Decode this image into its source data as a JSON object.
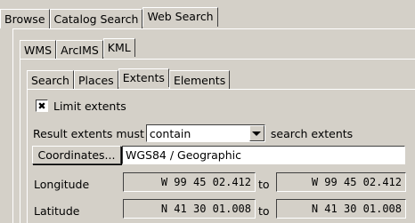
{
  "top_tabs": [
    "Browse",
    "Catalog Search",
    "Web Search"
  ],
  "service_tabs": [
    "WMS",
    "ArcIMS",
    "KML"
  ],
  "kml_tabs": [
    "Search",
    "Places",
    "Extents",
    "Elements"
  ],
  "limit_extents": {
    "label": "Limit extents",
    "checked": true,
    "mark": "✖"
  },
  "result_extents": {
    "prefix": "Result extents must",
    "value": "contain",
    "suffix": "search extents"
  },
  "coordinates": {
    "button_label": "Coordinates...",
    "system": "WGS84 / Geographic"
  },
  "longitude": {
    "label": "Longitude",
    "from": "W 99 45 02.412",
    "to_label": "to",
    "to": "W 99 45 02.412"
  },
  "latitude": {
    "label": "Latitude",
    "from": "N 41 30 01.008",
    "to_label": "to",
    "to": "N 41 30 01.008"
  }
}
